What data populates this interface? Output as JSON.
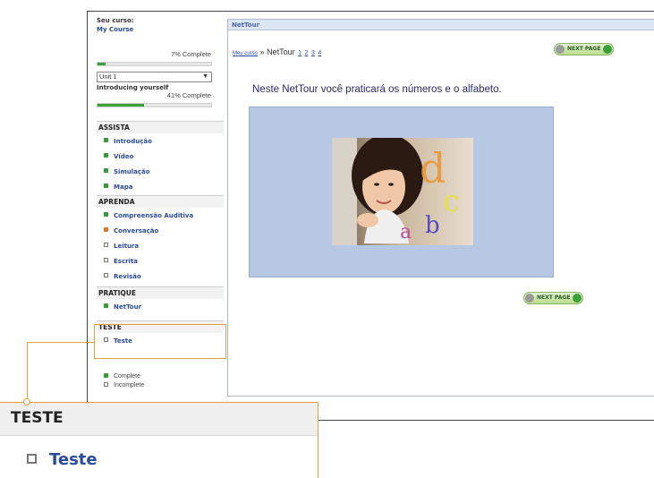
{
  "sidebar": {
    "course_label": "Seu curso:",
    "course_name": "My Course",
    "course_progress": "7% Complete",
    "course_progress_value": 7,
    "unit_select": "Unit 1",
    "lesson_title": "Introducing yourself",
    "lesson_progress": "41% Complete",
    "lesson_progress_value": 41,
    "sections": [
      {
        "title": "ASSISTA",
        "items": [
          {
            "label": "Introdução",
            "status": "done"
          },
          {
            "label": "Vídeo",
            "status": "done"
          },
          {
            "label": "Simulação",
            "status": "done"
          },
          {
            "label": "Mapa",
            "status": "done"
          }
        ]
      },
      {
        "title": "APRENDA",
        "items": [
          {
            "label": "Compreensão Auditiva",
            "status": "done"
          },
          {
            "label": "Conversação",
            "status": "in-progress"
          },
          {
            "label": "Leitura",
            "status": "todo"
          },
          {
            "label": "Escrita",
            "status": "todo"
          },
          {
            "label": "Revisão",
            "status": "todo"
          }
        ]
      },
      {
        "title": "PRATIQUE",
        "items": [
          {
            "label": "NetTour",
            "status": "done"
          }
        ]
      },
      {
        "title": "TESTE",
        "items": [
          {
            "label": "Teste",
            "status": "todo"
          }
        ]
      }
    ],
    "legend": {
      "complete": "Complete",
      "incomplete": "Incomplete"
    }
  },
  "panel": {
    "title": "NetTour",
    "breadcrumb_home": "Meu curso",
    "breadcrumb_sep": "»",
    "breadcrumb_current": "NetTour",
    "pages": [
      "1",
      "2",
      "3",
      "4"
    ],
    "next_page_label": "NEXT PAGE",
    "intro_text": "Neste NetTour você praticará os números e o alfabeto.",
    "image_letters": [
      "d",
      "c",
      "a",
      "b"
    ]
  },
  "zoom": {
    "title": "TESTE",
    "item": "Teste"
  },
  "colors": {
    "accent": "#e5a23b",
    "link": "#2a4a9a",
    "complete": "#3a9a3a",
    "in_progress": "#d47b2e"
  }
}
